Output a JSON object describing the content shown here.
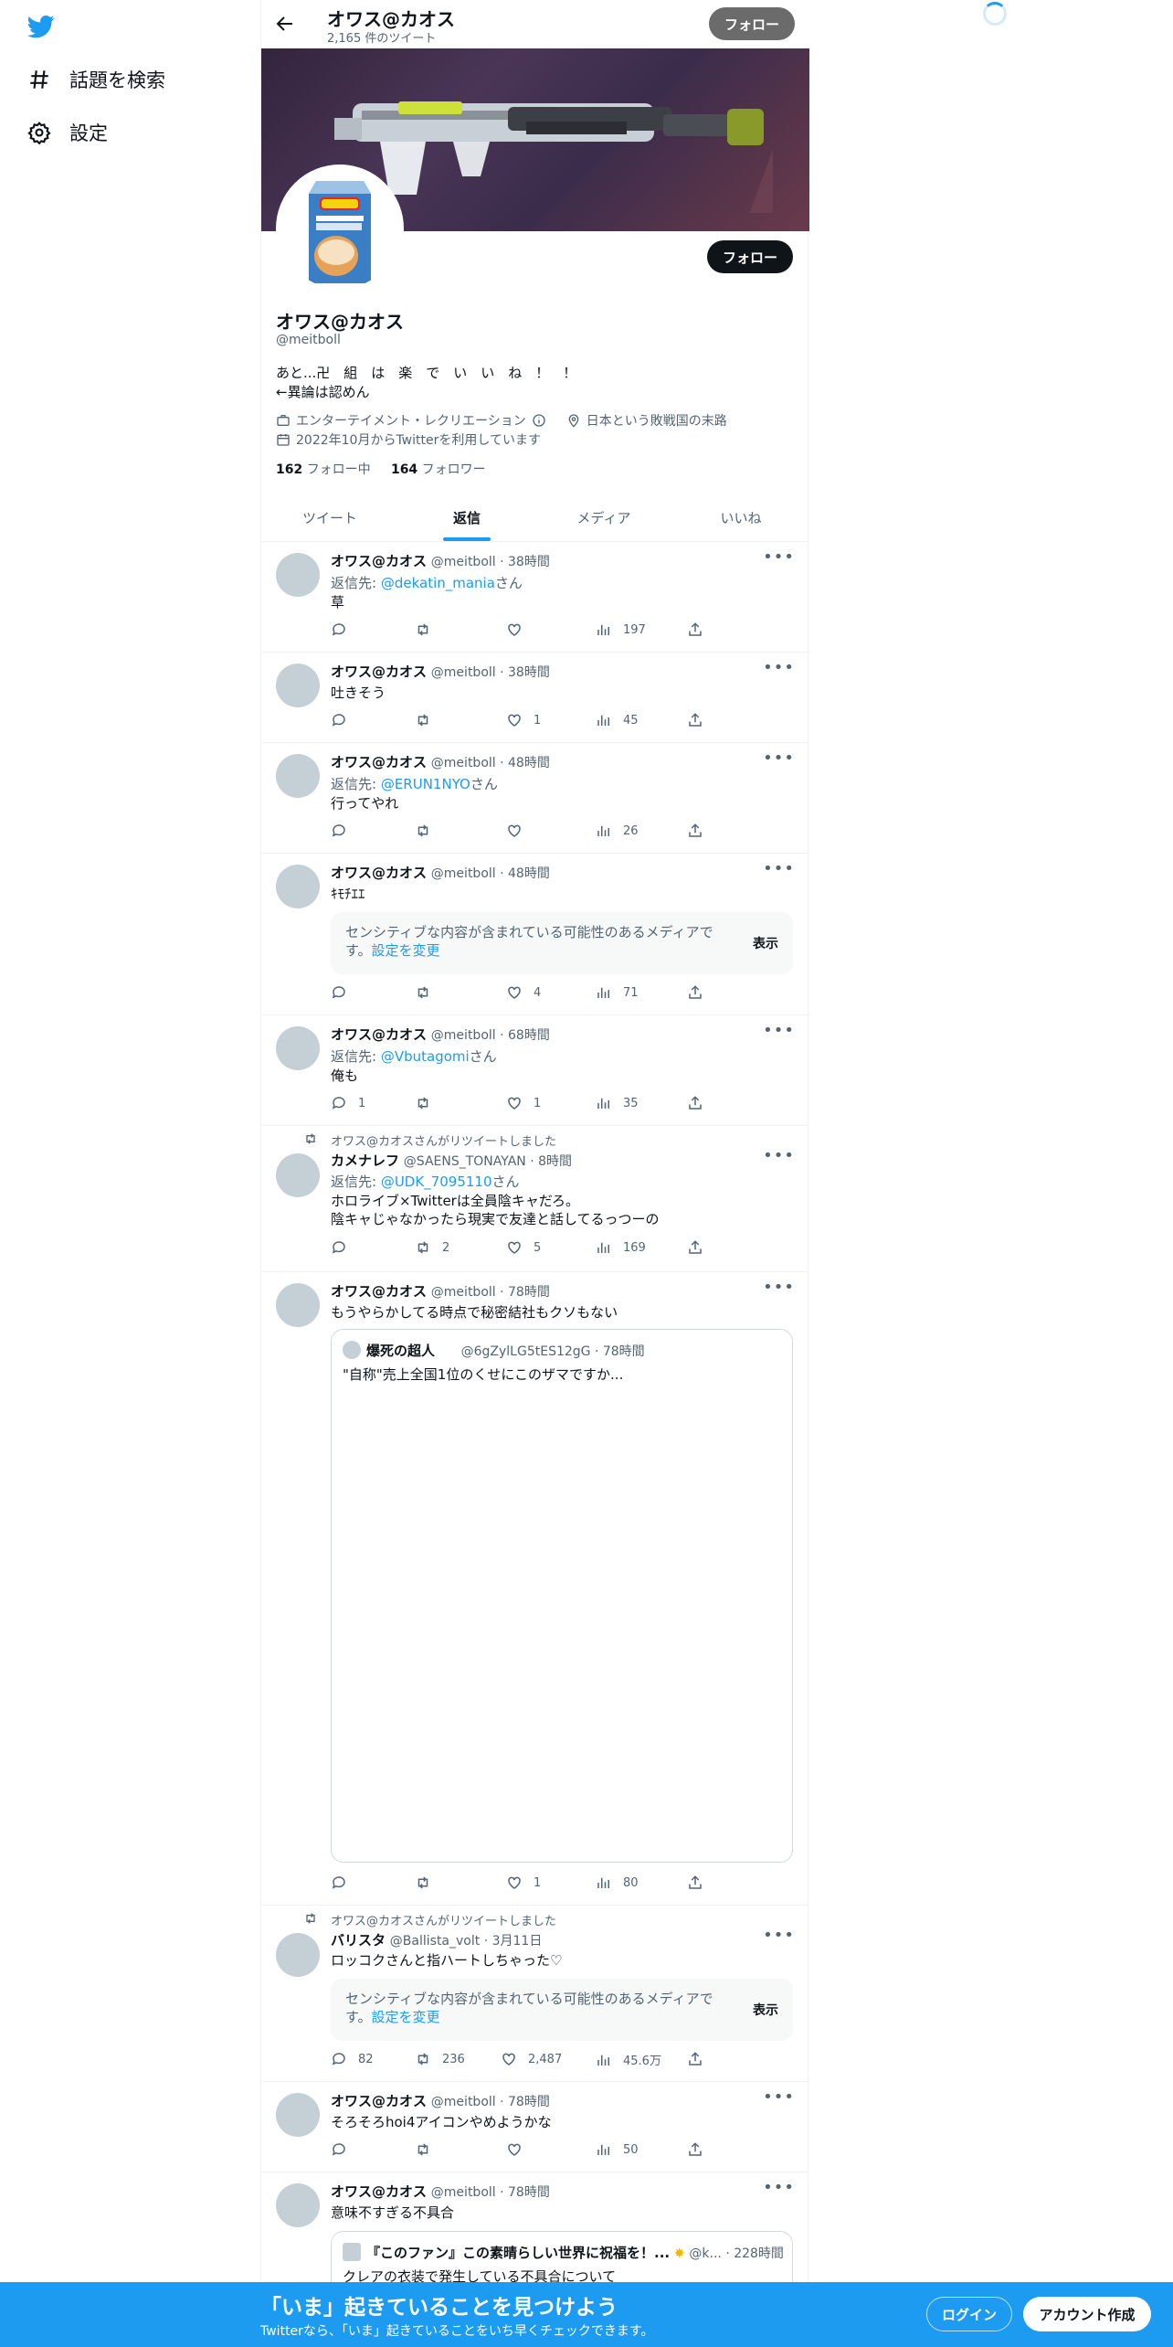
{
  "sidebar": {
    "items": [
      {
        "label": "話題を検索",
        "icon": "hashtag-icon"
      },
      {
        "label": "設定",
        "icon": "gear-icon"
      }
    ]
  },
  "header": {
    "name": "オワス@カオス",
    "tweet_count": "2,165 件のツイート",
    "follow_label": "フォロー"
  },
  "profile": {
    "name": "オワス@カオス",
    "handle": "@meitboll",
    "follow_label": "フォロー",
    "bio": "あと...卍　組　は　楽　で　い　い　ね　！　！\n←異論は認めん",
    "category": "エンターテイメント・レクリエーション",
    "location": "日本という敗戦国の末路",
    "joined": "2022年10月からTwitterを利用しています",
    "following_count": "162",
    "following_label": "フォロー中",
    "followers_count": "164",
    "followers_label": "フォロワー"
  },
  "tabs": [
    "ツイート",
    "返信",
    "メディア",
    "いいね"
  ],
  "tweets": [
    {
      "name": "オワス@カオス",
      "meta": "@meitboll · 38時間",
      "reply_prefix": "返信先: ",
      "reply_to": "@dekatin_mania",
      "reply_suffix": "さん",
      "text": "草",
      "replies": "",
      "retweets": "",
      "likes": "",
      "views": "197"
    },
    {
      "name": "オワス@カオス",
      "meta": "@meitboll · 38時間",
      "text": "吐きそう",
      "replies": "",
      "retweets": "",
      "likes": "1",
      "views": "45"
    },
    {
      "name": "オワス@カオス",
      "meta": "@meitboll · 48時間",
      "reply_prefix": "返信先: ",
      "reply_to": "@ERUN1NYO",
      "reply_suffix": "さん",
      "text": "行ってやれ",
      "replies": "",
      "retweets": "",
      "likes": "",
      "views": "26"
    },
    {
      "name": "オワス@カオス",
      "meta": "@meitboll · 48時間",
      "text": "ｷﾓﾁｴｴ",
      "sensitive_msg": "センシティブな内容が含まれている可能性のあるメディアです。",
      "sensitive_link": "設定を変更",
      "show_label": "表示",
      "replies": "",
      "retweets": "",
      "likes": "4",
      "views": "71"
    },
    {
      "name": "オワス@カオス",
      "meta": "@meitboll · 68時間",
      "reply_prefix": "返信先: ",
      "reply_to": "@Vbutagomi",
      "reply_suffix": "さん",
      "text": "俺も",
      "replies": "1",
      "retweets": "",
      "likes": "1",
      "views": "35"
    },
    {
      "retweeted_by": "オワス@カオスさんがリツイートしました",
      "name": "カメナレフ",
      "meta": "@SAENS_TONAYAN · 8時間",
      "reply_prefix": "返信先: ",
      "reply_to": "@UDK_7095110",
      "reply_suffix": "さん",
      "text": "ホロライブ×Twitterは全員陰キャだろ。\n陰キャじゃなかったら現実で友達と話してるっつーの",
      "replies": "",
      "retweets": "2",
      "likes": "5",
      "views": "169"
    },
    {
      "name": "オワス@カオス",
      "meta": "@meitboll · 78時間",
      "text": "もうやらかしてる時点で秘密結社もクソもない",
      "quote_name": "爆死の超人",
      "quote_meta": "@6gZylLG5tES12gG · 78時間",
      "quote_text": "\"自称\"売上全国1位のくせにこのザマですか...",
      "replies": "",
      "retweets": "",
      "likes": "1",
      "views": "80"
    },
    {
      "retweeted_by": "オワス@カオスさんがリツイートしました",
      "name": "バリスタ",
      "meta": "@Ballista_volt · 3月11日",
      "text": "ロッコクさんと指ハートしちゃった♡",
      "sensitive_msg": "センシティブな内容が含まれている可能性のあるメディアです。",
      "sensitive_link": "設定を変更",
      "show_label": "表示",
      "replies": "82",
      "retweets": "236",
      "likes": "2,487",
      "views": "45.6万"
    },
    {
      "name": "オワス@カオス",
      "meta": "@meitboll · 78時間",
      "text": "そろそろhoi4アイコンやめようかな",
      "replies": "",
      "retweets": "",
      "likes": "",
      "views": "50"
    },
    {
      "name": "オワス@カオス",
      "meta": "@meitboll · 78時間",
      "text": "意味不すぎる不具合",
      "quote_name": "『このファン』この素晴らしい世界に祝福を！...",
      "quote_meta": "@k... · 228時間",
      "quote_text": "クレアの衣装で発生している不具合について"
    }
  ],
  "bottom_bar": {
    "title": "「いま」起きていることを見つけよう",
    "subtitle": "Twitterなら、「いま」起きていることをいち早くチェックできます。",
    "login": "ログイン",
    "signup": "アカウント作成"
  },
  "colors": {
    "accent": "#1d9bf0",
    "text": "#0f1419",
    "muted": "#536471"
  }
}
